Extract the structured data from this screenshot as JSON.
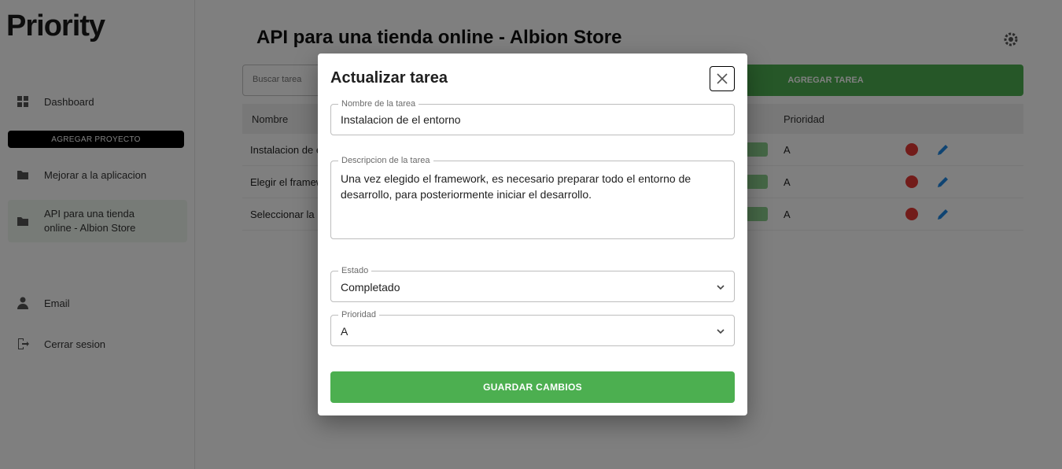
{
  "app": {
    "logo": "Priority"
  },
  "sidebar": {
    "dashboard": "Dashboard",
    "add_project": "AGREGAR PROYECTO",
    "projects": [
      "Mejorar a la aplicacion",
      "API para una tienda online - Albion Store"
    ],
    "email": "Email",
    "logout": "Cerrar sesion"
  },
  "main": {
    "title": "API para una tienda online - Albion Store",
    "search_placeholder": "Buscar tarea",
    "add_task": "AGREGAR TAREA",
    "columns": {
      "name": "Nombre",
      "priority": "Prioridad"
    },
    "rows": [
      {
        "name": "Instalacion de el entorno",
        "priority": "A"
      },
      {
        "name": "Elegir el framework",
        "priority": "A"
      },
      {
        "name": "Seleccionar la base de datos",
        "priority": "A"
      }
    ]
  },
  "modal": {
    "title": "Actualizar tarea",
    "name_label": "Nombre de la tarea",
    "name_value": "Instalacion de el entorno",
    "desc_label": "Descripcion de la tarea",
    "desc_value": "Una vez elegido el framework, es necesario preparar todo el entorno de desarrollo, para posteriormente iniciar el desarrollo.",
    "status_label": "Estado",
    "status_value": "Completado",
    "priority_label": "Prioridad",
    "priority_value": "A",
    "save_label": "GUARDAR CAMBIOS"
  },
  "colors": {
    "accent": "#4caf50",
    "danger": "#e53935",
    "edit": "#1e88e5"
  },
  "icons": {
    "close": "close-icon",
    "chevron": "chevron-down-icon"
  }
}
